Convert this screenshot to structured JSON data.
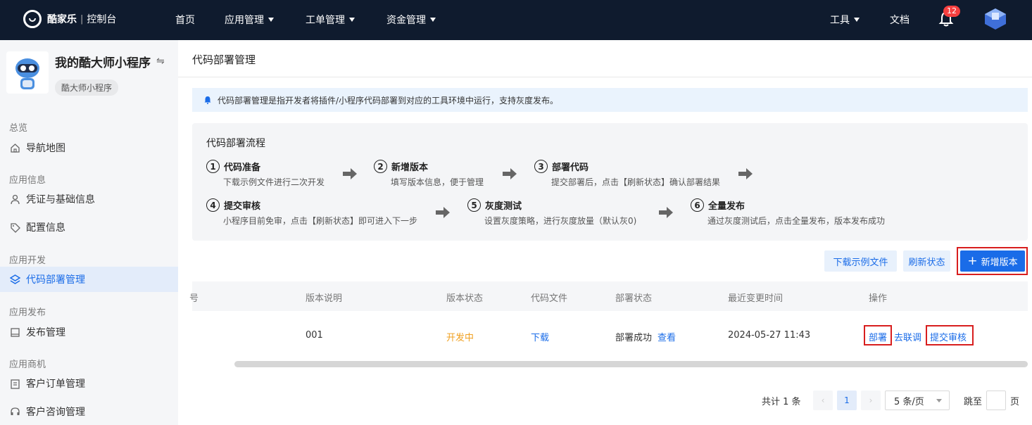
{
  "topbar": {
    "brand": "酷家乐",
    "sep": "|",
    "console": "控制台",
    "nav": [
      {
        "label": "首页"
      },
      {
        "label": "应用管理"
      },
      {
        "label": "工单管理"
      },
      {
        "label": "资金管理"
      }
    ],
    "tools": "工具",
    "docs": "文档",
    "notification_count": "12"
  },
  "sidebar": {
    "app_name": "我的酷大师小程序",
    "app_tag": "酷大师小程序",
    "sections": [
      {
        "title": "总览",
        "items": [
          {
            "label": "导航地图",
            "icon": "home-icon"
          }
        ]
      },
      {
        "title": "应用信息",
        "items": [
          {
            "label": "凭证与基础信息",
            "icon": "user-icon"
          },
          {
            "label": "配置信息",
            "icon": "tag-icon"
          }
        ]
      },
      {
        "title": "应用开发",
        "items": [
          {
            "label": "代码部署管理",
            "icon": "layers-icon",
            "active": true
          }
        ]
      },
      {
        "title": "应用发布",
        "items": [
          {
            "label": "发布管理",
            "icon": "book-icon"
          }
        ]
      },
      {
        "title": "应用商机",
        "items": [
          {
            "label": "客户订单管理",
            "icon": "clipboard-icon"
          },
          {
            "label": "客户咨询管理",
            "icon": "headset-icon"
          }
        ]
      }
    ]
  },
  "main": {
    "title": "代码部署管理",
    "notice": "代码部署管理是指开发者将插件/小程序代码部署到对应的工具环境中运行，支持灰度发布。",
    "flow": {
      "title": "代码部署流程",
      "steps": [
        {
          "num": "1",
          "title": "代码准备",
          "desc": "下载示例文件进行二次开发"
        },
        {
          "num": "2",
          "title": "新增版本",
          "desc": "填写版本信息，便于管理"
        },
        {
          "num": "3",
          "title": "部署代码",
          "desc": "提交部署后，点击【刷新状态】确认部署结果"
        },
        {
          "num": "4",
          "title": "提交审核",
          "desc": "小程序目前免审，点击【刷新状态】即可进入下一步"
        },
        {
          "num": "5",
          "title": "灰度测试",
          "desc": "设置灰度策略，进行灰度放量（默认灰0)"
        },
        {
          "num": "6",
          "title": "全量发布",
          "desc": "通过灰度测试后，点击全量发布，版本发布成功"
        }
      ]
    },
    "actions": {
      "download_sample": "下载示例文件",
      "refresh": "刷新状态",
      "add_version": "新增版本"
    },
    "table": {
      "columns": [
        "号",
        "版本说明",
        "版本状态",
        "代码文件",
        "部署状态",
        "最近变更时间",
        "操作"
      ],
      "rows": [
        {
          "desc": "001",
          "status": "开发中",
          "file": "下载",
          "deploy_status": "部署成功",
          "deploy_view": "查看",
          "updated": "2024-05-27 11:43",
          "ops": [
            "部署",
            "去联调",
            "提交审核"
          ]
        }
      ]
    },
    "pagination": {
      "total": "共计 1 条",
      "current": "1",
      "page_size": "5 条/页",
      "jump_label": "跳至",
      "page_label": "页"
    }
  },
  "colors": {
    "primary": "#1a6ce8",
    "topbar_bg": "#0f1b2e",
    "dev_status": "#f0a020",
    "highlight": "#d81e1e"
  }
}
